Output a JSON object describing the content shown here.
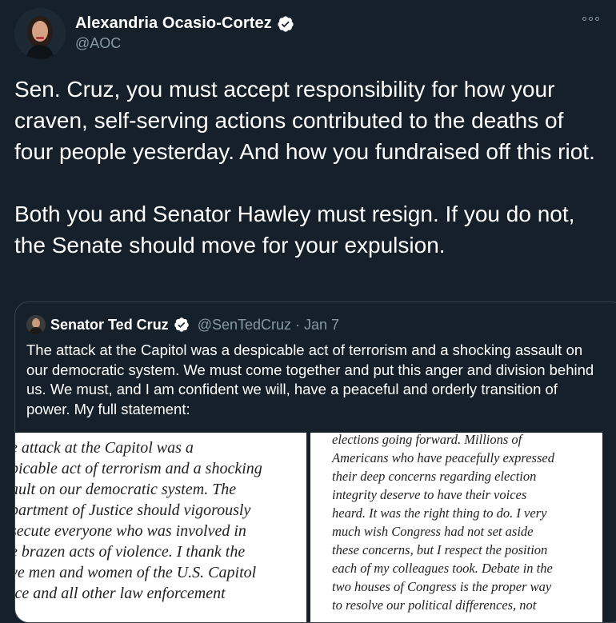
{
  "author": {
    "display_name": "Alexandria Ocasio-Cortez",
    "handle": "@AOC",
    "verified": true,
    "avatar_icon": "profile-photo"
  },
  "tweet": {
    "text": "Sen. Cruz, you must accept responsibility for how your craven, self-serving actions contributed to the deaths of four people yesterday. And how you fundraised off this riot.\n\nBoth you and Senator Hawley must resign. If you do not, the Senate should move for your expulsion."
  },
  "quoted_tweet": {
    "display_name": "Senator Ted Cruz",
    "handle_date": "@SenTedCruz · Jan 7",
    "text": "The attack at the Capitol was a despicable act of terrorism and a shocking assault on our democratic system. We must come together and put this anger and division behind us. We must, and I am confident we will, have a peaceful and orderly transition of power. My full statement:",
    "statement_left_lines": [
      "e attack at the Capitol was a",
      "picable act of terrorism and a shocking",
      "ault on our democratic system. The",
      "partment of Justice should vigorously",
      "secute everyone who was involved in",
      "e brazen acts of violence. I thank the",
      "ve men and women of the U.S. Capitol",
      "ice and all other law enforcement"
    ],
    "statement_right_lines": [
      "elections going forward. Millions of",
      "Americans who have peacefully expressed",
      "their deep concerns regarding election",
      "integrity deserve to have their voices",
      "heard. It was the right thing to do. I very",
      "much wish Congress had not set aside",
      "these concerns, but I respect the position",
      "each of my colleagues took. Debate in the",
      "two houses of Congress is the proper way",
      "to resolve our political differences, not"
    ]
  },
  "colors": {
    "background": "#15202b",
    "secondary_text": "#8899a6",
    "border": "#38444d",
    "verified_blue": "#1da1f2"
  }
}
